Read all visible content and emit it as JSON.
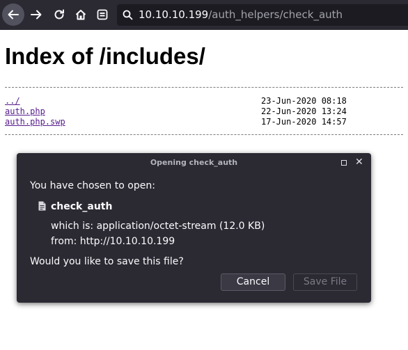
{
  "browser": {
    "url_host": "10.10.10.199",
    "url_path": "/auth_helpers/check_auth",
    "icons": [
      "back-arrow-icon",
      "forward-arrow-icon",
      "reload-icon",
      "home-icon",
      "reader-view-icon",
      "search-icon"
    ]
  },
  "page": {
    "title": "Index of /includes/",
    "entries": [
      {
        "name": "../",
        "date": "23-Jun-2020 08:18"
      },
      {
        "name": "auth.php",
        "date": "22-Jun-2020 13:24"
      },
      {
        "name": "auth.php.swp",
        "date": "17-Jun-2020 14:57"
      }
    ]
  },
  "dialog": {
    "title": "Opening check_auth",
    "intro": "You have chosen to open:",
    "filename": "check_auth",
    "type_line": "which is: application/octet-stream (12.0 KB)",
    "from_line": "from: http://10.10.10.199",
    "question": "Would you like to save this file?",
    "cancel_label": "Cancel",
    "save_label": "Save File",
    "close_glyph": "✕"
  },
  "colors": {
    "toolbar_bg": "#2b2a33",
    "urlbar_bg": "#1c1b22",
    "link": "#551a8b",
    "dialog_bg": "#2b2a33"
  }
}
